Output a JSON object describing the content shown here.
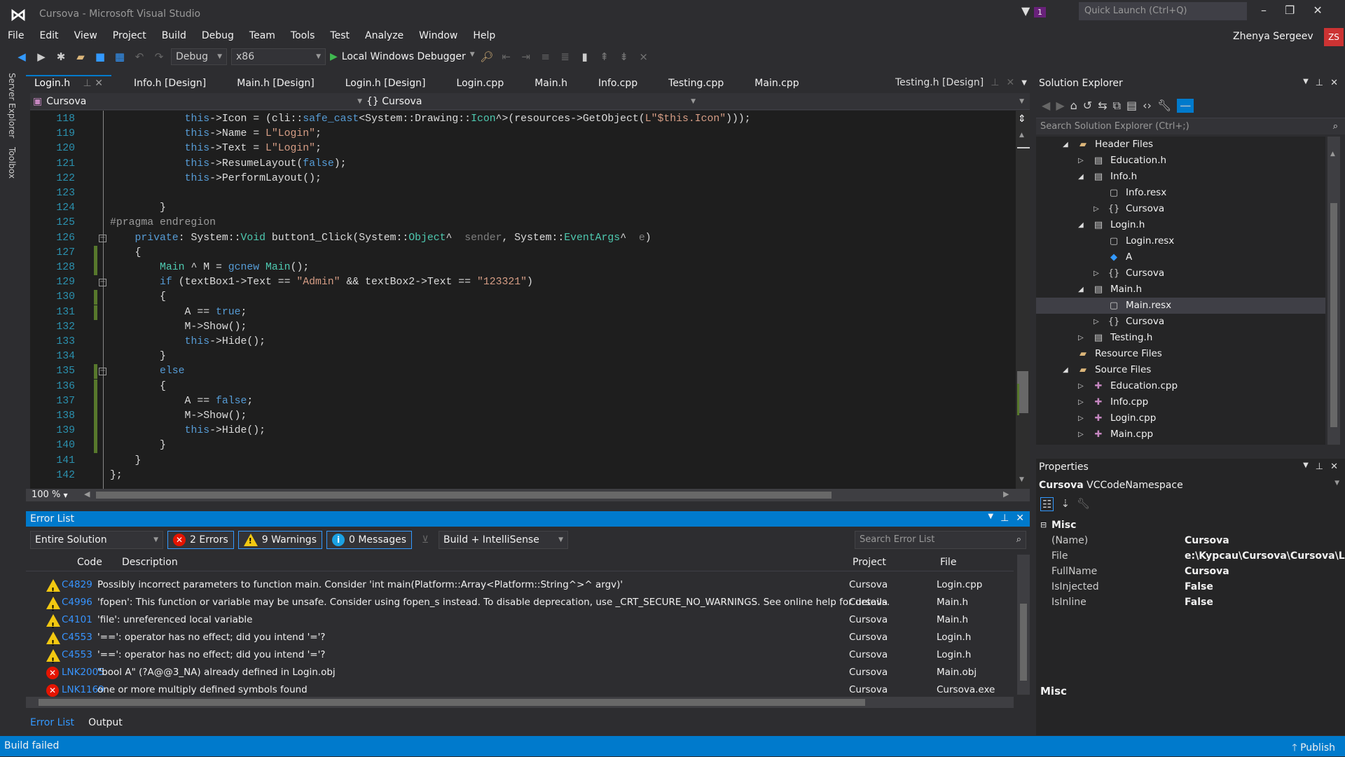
{
  "window": {
    "title": "Cursova - Microsoft Visual Studio",
    "quick_launch_placeholder": "Quick Launch (Ctrl+Q)",
    "notification_count": "1",
    "user": "Zhenya Sergeev",
    "user_initials": "ZS"
  },
  "menu": [
    "File",
    "Edit",
    "View",
    "Project",
    "Build",
    "Debug",
    "Team",
    "Tools",
    "Test",
    "Analyze",
    "Window",
    "Help"
  ],
  "toolbar": {
    "configuration": "Debug",
    "platform": "x86",
    "debugger": "Local Windows Debugger"
  },
  "side_tabs": [
    "Server Explorer",
    "Toolbox"
  ],
  "tabs": [
    {
      "label": "Login.h",
      "active": true
    },
    {
      "label": "Info.h [Design]"
    },
    {
      "label": "Main.h [Design]"
    },
    {
      "label": "Login.h [Design]"
    },
    {
      "label": "Login.cpp"
    },
    {
      "label": "Main.h"
    },
    {
      "label": "Info.cpp"
    },
    {
      "label": "Testing.cpp"
    },
    {
      "label": "Main.cpp"
    }
  ],
  "pinned_tab": "Testing.h [Design]",
  "navbar": {
    "project": "Cursova",
    "scope": "{} Cursova"
  },
  "editor": {
    "zoom": "100 %",
    "lines": [
      {
        "n": "118",
        "tokens": [
          [
            "            ",
            "plain"
          ],
          [
            "this",
            "kw"
          ],
          [
            "->Icon = (cli::",
            "plain"
          ],
          [
            "safe_cast",
            "kw"
          ],
          [
            "<System::Drawing::",
            "plain"
          ],
          [
            "Icon",
            "type"
          ],
          [
            "^>(resources->GetObject(",
            "plain"
          ],
          [
            "L\"$this.Icon\"",
            "str"
          ],
          [
            ")));",
            "plain"
          ]
        ]
      },
      {
        "n": "119",
        "tokens": [
          [
            "            ",
            "plain"
          ],
          [
            "this",
            "kw"
          ],
          [
            "->Name = ",
            "plain"
          ],
          [
            "L\"Login\"",
            "str"
          ],
          [
            ";",
            "plain"
          ]
        ]
      },
      {
        "n": "120",
        "tokens": [
          [
            "            ",
            "plain"
          ],
          [
            "this",
            "kw"
          ],
          [
            "->Text = ",
            "plain"
          ],
          [
            "L\"Login\"",
            "str"
          ],
          [
            ";",
            "plain"
          ]
        ]
      },
      {
        "n": "121",
        "tokens": [
          [
            "            ",
            "plain"
          ],
          [
            "this",
            "kw"
          ],
          [
            "->ResumeLayout(",
            "plain"
          ],
          [
            "false",
            "kw"
          ],
          [
            ");",
            "plain"
          ]
        ]
      },
      {
        "n": "122",
        "tokens": [
          [
            "            ",
            "plain"
          ],
          [
            "this",
            "kw"
          ],
          [
            "->PerformLayout();",
            "plain"
          ]
        ]
      },
      {
        "n": "123",
        "tokens": []
      },
      {
        "n": "124",
        "tokens": [
          [
            "        }",
            "plain"
          ]
        ]
      },
      {
        "n": "125",
        "tokens": [
          [
            "#pragma endregion",
            "cm"
          ]
        ]
      },
      {
        "n": "126",
        "fold": true,
        "tokens": [
          [
            "    ",
            "plain"
          ],
          [
            "private",
            "kw"
          ],
          [
            ": System::",
            "plain"
          ],
          [
            "Void",
            "type"
          ],
          [
            " button1_Click(System::",
            "plain"
          ],
          [
            "Object",
            "type"
          ],
          [
            "^  ",
            "plain"
          ],
          [
            "sender",
            "param"
          ],
          [
            ", System::",
            "plain"
          ],
          [
            "EventArgs",
            "type"
          ],
          [
            "^  ",
            "plain"
          ],
          [
            "e",
            "param"
          ],
          [
            ")",
            "plain"
          ]
        ]
      },
      {
        "n": "127",
        "changed": true,
        "tokens": [
          [
            "    {",
            "plain"
          ]
        ]
      },
      {
        "n": "128",
        "changed": true,
        "tokens": [
          [
            "        ",
            "plain"
          ],
          [
            "Main",
            "type"
          ],
          [
            " ^ M = ",
            "plain"
          ],
          [
            "gcnew",
            "kw"
          ],
          [
            " ",
            "plain"
          ],
          [
            "Main",
            "type"
          ],
          [
            "();",
            "plain"
          ]
        ]
      },
      {
        "n": "129",
        "fold": true,
        "tokens": [
          [
            "        ",
            "plain"
          ],
          [
            "if",
            "kw"
          ],
          [
            " (textBox1->Text == ",
            "plain"
          ],
          [
            "\"Admin\"",
            "str"
          ],
          [
            " && textBox2->Text == ",
            "plain"
          ],
          [
            "\"123321\"",
            "str"
          ],
          [
            ")",
            "plain"
          ]
        ]
      },
      {
        "n": "130",
        "changed": true,
        "tokens": [
          [
            "        {",
            "plain"
          ]
        ]
      },
      {
        "n": "131",
        "changed": true,
        "tokens": [
          [
            "            A == ",
            "plain"
          ],
          [
            "true",
            "kw"
          ],
          [
            ";",
            "plain"
          ]
        ]
      },
      {
        "n": "132",
        "tokens": [
          [
            "            M->Show();",
            "plain"
          ]
        ]
      },
      {
        "n": "133",
        "tokens": [
          [
            "            ",
            "plain"
          ],
          [
            "this",
            "kw"
          ],
          [
            "->Hide();",
            "plain"
          ]
        ]
      },
      {
        "n": "134",
        "tokens": [
          [
            "        }",
            "plain"
          ]
        ]
      },
      {
        "n": "135",
        "fold": true,
        "changed": true,
        "tokens": [
          [
            "        ",
            "plain"
          ],
          [
            "else",
            "kw"
          ]
        ]
      },
      {
        "n": "136",
        "changed": true,
        "tokens": [
          [
            "        {",
            "plain"
          ]
        ]
      },
      {
        "n": "137",
        "changed": true,
        "tokens": [
          [
            "            A == ",
            "plain"
          ],
          [
            "false",
            "kw"
          ],
          [
            ";",
            "plain"
          ]
        ]
      },
      {
        "n": "138",
        "changed": true,
        "tokens": [
          [
            "            M->Show();",
            "plain"
          ]
        ]
      },
      {
        "n": "139",
        "changed": true,
        "tokens": [
          [
            "            ",
            "plain"
          ],
          [
            "this",
            "kw"
          ],
          [
            "->Hide();",
            "plain"
          ]
        ]
      },
      {
        "n": "140",
        "changed": true,
        "tokens": [
          [
            "        }",
            "plain"
          ]
        ]
      },
      {
        "n": "141",
        "tokens": [
          [
            "    }",
            "plain"
          ]
        ]
      },
      {
        "n": "142",
        "tokens": [
          [
            "};",
            "plain"
          ]
        ]
      }
    ]
  },
  "error_list": {
    "title": "Error List",
    "scope": "Entire Solution",
    "errors": "2 Errors",
    "warnings": "9 Warnings",
    "messages": "0 Messages",
    "source": "Build + IntelliSense",
    "search_placeholder": "Search Error List",
    "columns": {
      "code": "Code",
      "description": "Description",
      "project": "Project",
      "file": "File"
    },
    "rows": [
      {
        "type": "warning",
        "code": "C4829",
        "description": "Possibly incorrect parameters to function main. Consider 'int main(Platform::Array<Platform::String^>^ argv)'",
        "project": "Cursova",
        "file": "Login.cpp"
      },
      {
        "type": "warning",
        "code": "C4996",
        "description": "'fopen': This function or variable may be unsafe. Consider using fopen_s instead. To disable deprecation, use _CRT_SECURE_NO_WARNINGS. See online help for details.",
        "project": "Cursova",
        "file": "Main.h"
      },
      {
        "type": "warning",
        "code": "C4101",
        "description": "'file': unreferenced local variable",
        "project": "Cursova",
        "file": "Main.h"
      },
      {
        "type": "warning",
        "code": "C4553",
        "description": "'==': operator has no effect; did you intend '='?",
        "project": "Cursova",
        "file": "Login.h"
      },
      {
        "type": "warning",
        "code": "C4553",
        "description": "'==': operator has no effect; did you intend '='?",
        "project": "Cursova",
        "file": "Login.h"
      },
      {
        "type": "error",
        "code": "LNK2005",
        "description": "\"bool A\" (?A@@3_NA) already defined in Login.obj",
        "project": "Cursova",
        "file": "Main.obj"
      },
      {
        "type": "error",
        "code": "LNK1169",
        "description": "one or more multiply defined symbols found",
        "project": "Cursova",
        "file": "Cursova.exe"
      }
    ]
  },
  "bottom_tabs": [
    "Error List",
    "Output"
  ],
  "status": {
    "text": "Build failed",
    "publish": "Publish"
  },
  "solution_explorer": {
    "title": "Solution Explorer",
    "search_placeholder": "Search Solution Explorer (Ctrl+;)",
    "items": [
      {
        "label": "Header Files",
        "level": 0,
        "state": "expanded",
        "icon": "filter-folder-icon"
      },
      {
        "label": "Education.h",
        "level": 1,
        "state": "collapsed",
        "icon": "header-file-icon"
      },
      {
        "label": "Info.h",
        "level": 1,
        "state": "expanded",
        "icon": "header-file-icon"
      },
      {
        "label": "Info.resx",
        "level": 2,
        "state": "none",
        "icon": "resx-file-icon"
      },
      {
        "label": "Cursova",
        "level": 2,
        "state": "collapsed",
        "icon": "namespace-icon"
      },
      {
        "label": "Login.h",
        "level": 1,
        "state": "expanded",
        "icon": "header-file-icon"
      },
      {
        "label": "Login.resx",
        "level": 2,
        "state": "none",
        "icon": "resx-file-icon"
      },
      {
        "label": "A",
        "level": 2,
        "state": "none",
        "icon": "variable-icon"
      },
      {
        "label": "Cursova",
        "level": 2,
        "state": "collapsed",
        "icon": "namespace-icon"
      },
      {
        "label": "Main.h",
        "level": 1,
        "state": "expanded",
        "icon": "header-file-icon"
      },
      {
        "label": "Main.resx",
        "level": 2,
        "state": "none",
        "icon": "resx-file-icon",
        "selected": true
      },
      {
        "label": "Cursova",
        "level": 2,
        "state": "collapsed",
        "icon": "namespace-icon"
      },
      {
        "label": "Testing.h",
        "level": 1,
        "state": "collapsed",
        "icon": "header-file-icon"
      },
      {
        "label": "Resource Files",
        "level": 0,
        "state": "none",
        "icon": "filter-folder-icon"
      },
      {
        "label": "Source Files",
        "level": 0,
        "state": "expanded",
        "icon": "filter-folder-icon"
      },
      {
        "label": "Education.cpp",
        "level": 1,
        "state": "collapsed",
        "icon": "cpp-file-icon"
      },
      {
        "label": "Info.cpp",
        "level": 1,
        "state": "collapsed",
        "icon": "cpp-file-icon"
      },
      {
        "label": "Login.cpp",
        "level": 1,
        "state": "collapsed",
        "icon": "cpp-file-icon"
      },
      {
        "label": "Main.cpp",
        "level": 1,
        "state": "collapsed",
        "icon": "cpp-file-icon"
      }
    ]
  },
  "properties": {
    "title": "Properties",
    "object_name": "Cursova",
    "object_type": "VCCodeNamespace",
    "category": "Misc",
    "rows": [
      {
        "name": "(Name)",
        "value": "Cursova"
      },
      {
        "name": "File",
        "value": "e:\\Kypcau\\Cursova\\Cursova\\Login.h"
      },
      {
        "name": "FullName",
        "value": "Cursova"
      },
      {
        "name": "IsInjected",
        "value": "False"
      },
      {
        "name": "IsInline",
        "value": "False"
      }
    ],
    "description_title": "Misc"
  },
  "colors": {
    "accent": "#007acc",
    "keyword": "#569cd6",
    "string": "#d69d85",
    "type": "#4ec9b0",
    "line_number": "#2b91af",
    "change_bar": "#57782c"
  }
}
